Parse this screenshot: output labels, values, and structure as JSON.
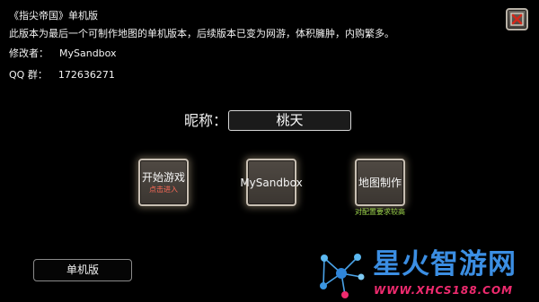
{
  "info": {
    "title": "《指尖帝国》单机版",
    "description": "此版本为最后一个可制作地图的单机版本，后续版本已变为网游，体积臃肿，内购繁多。",
    "author_label": "修改者：",
    "author_value": "MySandbox",
    "qq_label": "QQ 群：",
    "qq_value": "172636271"
  },
  "nickname": {
    "label": "昵称：",
    "value": "桃天"
  },
  "menu": {
    "start_label": "开始游戏",
    "start_hint": "点击进入",
    "sandbox_label": "MySandbox",
    "map_label": "地图制作",
    "map_hint": "对配置要求较高"
  },
  "single_mode_label": "单机版",
  "close_icon": "close-x-icon",
  "watermark": {
    "title": "星火智游网",
    "url": "WWW.XHCS188.COM"
  },
  "colors": {
    "hint_red": "#ff6a57",
    "hint_green": "#9ad24a",
    "watermark_blue": "#3b8ee3",
    "watermark_pink": "#ee2a6e"
  }
}
